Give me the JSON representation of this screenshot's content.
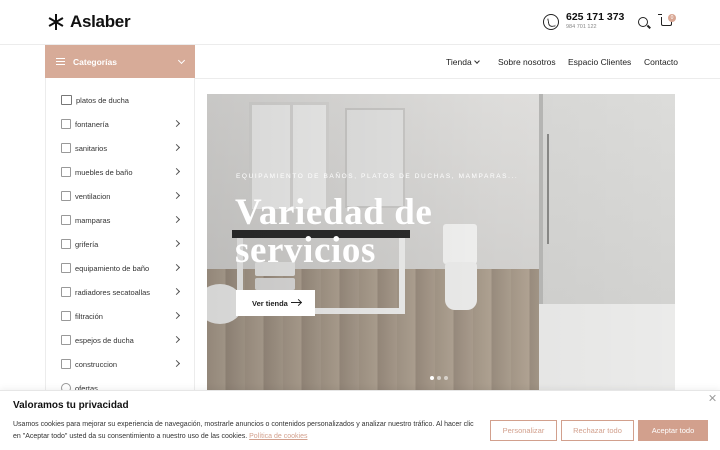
{
  "header": {
    "logo_text": "Aslaber",
    "phone_main": "625 171 373",
    "phone_sub": "984 701 122",
    "cart_count": "0"
  },
  "categories": {
    "title": "Categorías",
    "items": [
      {
        "label": "platos de ducha",
        "icon": "shower-tray-icon",
        "has_submenu": false
      },
      {
        "label": "fontanería",
        "icon": "faucet-icon",
        "has_submenu": true
      },
      {
        "label": "sanitarios",
        "icon": "toilet-icon",
        "has_submenu": true
      },
      {
        "label": "muebles de baño",
        "icon": "cabinet-icon",
        "has_submenu": true
      },
      {
        "label": "ventilacion",
        "icon": "fan-icon",
        "has_submenu": true
      },
      {
        "label": "mamparas",
        "icon": "shower-screen-icon",
        "has_submenu": true
      },
      {
        "label": "grifería",
        "icon": "tap-icon",
        "has_submenu": true
      },
      {
        "label": "equipamiento de baño",
        "icon": "bath-equipment-icon",
        "has_submenu": true
      },
      {
        "label": "radiadores secatoallas",
        "icon": "radiator-icon",
        "has_submenu": true
      },
      {
        "label": "filtración",
        "icon": "filter-icon",
        "has_submenu": true
      },
      {
        "label": "espejos de ducha",
        "icon": "mirror-icon",
        "has_submenu": true
      },
      {
        "label": "construccion",
        "icon": "construction-icon",
        "has_submenu": true
      },
      {
        "label": "ofertas",
        "icon": "offer-icon",
        "has_submenu": false
      }
    ]
  },
  "nav": {
    "tienda": "Tienda",
    "sobre": "Sobre nosotros",
    "espacio": "Espacio Clientes",
    "contacto": "Contacto"
  },
  "hero": {
    "kicker": "EQUIPAMIENTO DE BAÑOS, PLATOS DE DUCHAS, MAMPARAS...",
    "title_line1": "Variedad de",
    "title_line2": "servicios",
    "button": "Ver tienda",
    "slides": 3,
    "active_slide": 1
  },
  "cookie": {
    "title": "Valoramos tu privacidad",
    "text": "Usamos cookies para mejorar su experiencia de navegación, mostrarle anuncios o contenidos personalizados y analizar nuestro tráfico. Al hacer clic en \"Aceptar todo\" usted da su consentimiento a nuestro uso de las cookies.",
    "link": "Política de cookies",
    "btn_personalize": "Personalizar",
    "btn_reject": "Rechazar todo",
    "btn_accept": "Aceptar todo"
  },
  "colors": {
    "accent": "#d7ab98",
    "accent_dark": "#d2a08d"
  }
}
